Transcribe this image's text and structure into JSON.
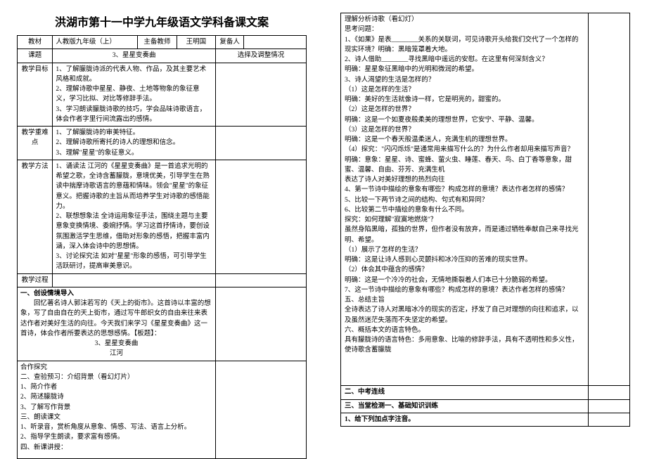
{
  "title": "洪湖市第十一中学九年级语文学科备课文案",
  "left": {
    "row1": {
      "l1": "教材",
      "v1": "人教版九年级（上）",
      "l2": "主备教师",
      "v2": "王明国",
      "l3": "复备人"
    },
    "row2": {
      "l": "课题",
      "v": "3、星星变奏曲",
      "r": "选择及调整情况"
    },
    "row3": {
      "l": "教学目标",
      "v": "1、了解朦胧诗派的代表人物、作品，及其主要艺术风格和成就。\n2、理解诗歌中星星、静夜、土地等物象的象征意义，学习比拟、对比等修辞手法。\n3、学习朗读朦胧诗歌的技巧，学会品味诗歌语言，体会作者字里行间流露出的感情。"
    },
    "row4": {
      "l": "教学重难点",
      "v": "1、了解朦胧诗的审美特征。\n2、理解诗歌所寄托的诗人的理想和信念。\n3、理解\"星星\"的象征意义。"
    },
    "row5": {
      "l": "教学方法",
      "v": "1、诵读法   江河的《星星变奏曲》是一首追求光明的希望之歌，全诗含蓄朦胧，意境优美，引导学生在熟读中揣摩诗歌语言的意蕴和情味。领会\"星星\"的象征意义。把握诗歌的主旨从而培养学生对诗歌的感悟能力。\n2、联想想象法   全诗运用象征手法，围绕主题与主要意象变换情境、委婉抒情。学习这首抒情诗，要创设氛围激活学生思维，借助对形象的感悟，把握丰富内涵，深入体会诗中的思想情。\n3、讨论探究法   如对\"星星\"形象的感悟，可引导学生活跃研讨，提高审美意识。"
    },
    "row6": {
      "l": "教学过程"
    },
    "row7": {
      "h": "一、创设情境导入",
      "b": "回忆著名诗人郭沫若写的《天上的街市》。这首诗以丰富的想象，写了自由自在的天上街市，通过写牛郎织女的自由来往来表达作者对美好生活的向往。今天我们来学习《星星变奏曲》这一首诗，体会作者所要表达的思想感情。【板题】：",
      "c1": "3、星星变奏曲",
      "c2": "江河"
    },
    "row8": {
      "h": "合作探究",
      "lines": [
        "二、查验预习：介绍背景（看幻灯片）",
        "1、简介作者",
        "2、简述朦胧诗",
        "3、了解写作背景",
        "三、朗读课文",
        "1、听录音，赏析角度从意象、情感、写法、语言上分析。",
        "2、指导学生朗读，要求富有感情。",
        "四、新课讲授："
      ]
    }
  },
  "right": {
    "block1_lines": [
      "理解分析诗歌（看幻灯）",
      "思考问题：",
      "1、《如果》是表________关系的关联词，可见诗歌开头给我们交代了一个怎样的现实环境？明确：黑暗笼罩着大地。",
      "2、诗人借助________寻找黑暗中遥远的安慰。在这里有何深刻含义？",
      "明确：星星象征黑暗中的光明和微润的希望。",
      "3、诗人渴望的生活是怎样的？",
      "（1）这是怎样的生活？",
      "    明确：美好的生活就像诗一样，它是明亮的，甜蜜的。",
      "（2）这是怎样的世界？",
      "    明确：这是一个如夏夜般柔美的理想世界，它安宁、平静、温馨。",
      "（3）这是怎样的世界？",
      "    明确：这是一个春天般温柔迷人，充满生机的理想世界。",
      "（4）探究：\"闪闪烁烁\"是通常用来描写什么的？为什么作者却用来描写声音？",
      "    明确：意象：星星、诗、蜜蜂、萤火虫、睡莲、春天、鸟、白丁香等意象，甜蜜、温馨、自由、芬芳、充满生机",
      "    表达了诗人对美好理想的热烈向往",
      "4、第一节诗中描绘的意象有哪些？构成怎样的意境？表达作者怎样的感情？",
      "5、比较一下两节诗之间的结构、句式有和异同？",
      "6、比较第二节中描绘的意象有什么不同。",
      "探究：如何理解\"寂寞地燃烧\"？",
      "    虽然身陷黑暗，孤独的世界，但作者没有放弃，而是通过牺牲奉献自己来寻找光明、希望。",
      "（1）展示了怎样的生活？",
      "明确：这是让诗人感到心灵颤抖和冰冷压抑的苦难的现实世界。",
      "（2）体会其中蕴含的感情？",
      "明确：这是一个冷冷的社会，无情地撕裂着人们本已十分脆弱的希望。",
      "7、这一节诗中描绘的意象有哪些？构成怎样的意境？表达作者怎样的感情？",
      "五、总结主旨",
      "全诗表达了诗人对黑暗冰冷的现实的否定，抒发了自己对理想的向往和追求，以及虽然迷茫失落而不失坚定的希望。",
      "六、概括本文的语言特色。",
      "具有朦胧诗的语言特色：多用意象、比喻的修辞手法，具有不透明性和多义性，使诗歌含蓄朦胧"
    ],
    "block2": "二、中考连线",
    "block3": "三、当堂检测一、基础知识训练",
    "block4": "1、给下列加点字注音。"
  }
}
